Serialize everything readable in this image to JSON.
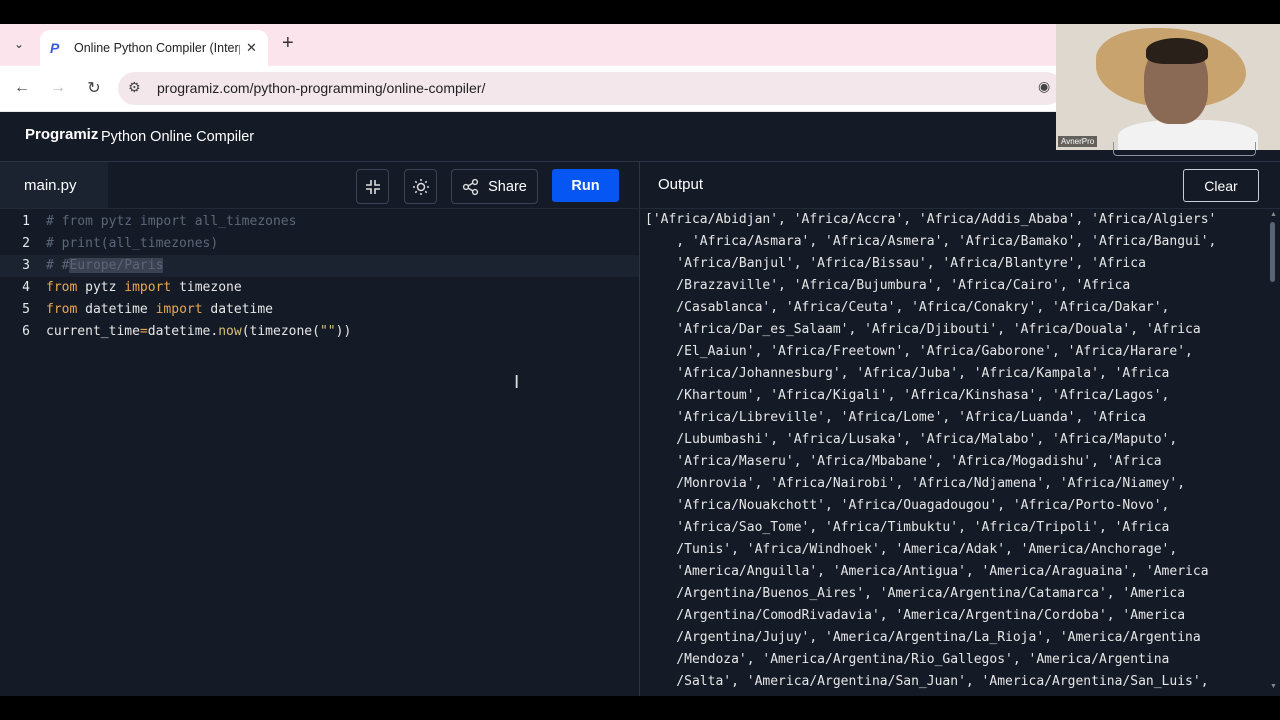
{
  "browser": {
    "tab_title": "Online Python Compiler (Interp",
    "url": "programiz.com/python-programming/online-compiler/"
  },
  "app": {
    "logo": "Programiz",
    "title": "Python Online Compiler"
  },
  "editor": {
    "filename": "main.py",
    "share_label": "Share",
    "run_label": "Run",
    "line_numbers": [
      "1",
      "2",
      "3",
      "4",
      "5",
      "6"
    ]
  },
  "output": {
    "title": "Output",
    "clear_label": "Clear",
    "lines": [
      "['Africa/Abidjan', 'Africa/Accra', 'Africa/Addis_Ababa', 'Africa/Algiers'",
      "    , 'Africa/Asmara', 'Africa/Asmera', 'Africa/Bamako', 'Africa/Bangui',",
      "    'Africa/Banjul', 'Africa/Bissau', 'Africa/Blantyre', 'Africa",
      "    /Brazzaville', 'Africa/Bujumbura', 'Africa/Cairo', 'Africa",
      "    /Casablanca', 'Africa/Ceuta', 'Africa/Conakry', 'Africa/Dakar',",
      "    'Africa/Dar_es_Salaam', 'Africa/Djibouti', 'Africa/Douala', 'Africa",
      "    /El_Aaiun', 'Africa/Freetown', 'Africa/Gaborone', 'Africa/Harare',",
      "    'Africa/Johannesburg', 'Africa/Juba', 'Africa/Kampala', 'Africa",
      "    /Khartoum', 'Africa/Kigali', 'Africa/Kinshasa', 'Africa/Lagos',",
      "    'Africa/Libreville', 'Africa/Lome', 'Africa/Luanda', 'Africa",
      "    /Lubumbashi', 'Africa/Lusaka', 'Africa/Malabo', 'Africa/Maputo',",
      "    'Africa/Maseru', 'Africa/Mbabane', 'Africa/Mogadishu', 'Africa",
      "    /Monrovia', 'Africa/Nairobi', 'Africa/Ndjamena', 'Africa/Niamey',",
      "    'Africa/Nouakchott', 'Africa/Ouagadougou', 'Africa/Porto-Novo',",
      "    'Africa/Sao_Tome', 'Africa/Timbuktu', 'Africa/Tripoli', 'Africa",
      "    /Tunis', 'Africa/Windhoek', 'America/Adak', 'America/Anchorage',",
      "    'America/Anguilla', 'America/Antigua', 'America/Araguaina', 'America",
      "    /Argentina/Buenos_Aires', 'America/Argentina/Catamarca', 'America",
      "    /Argentina/ComodRivadavia', 'America/Argentina/Cordoba', 'America",
      "    /Argentina/Jujuy', 'America/Argentina/La_Rioja', 'America/Argentina",
      "    /Mendoza', 'America/Argentina/Rio_Gallegos', 'America/Argentina",
      "    /Salta', 'America/Argentina/San_Juan', 'America/Argentina/San_Luis',"
    ]
  },
  "webcam": {
    "label": "AvnerPro"
  }
}
